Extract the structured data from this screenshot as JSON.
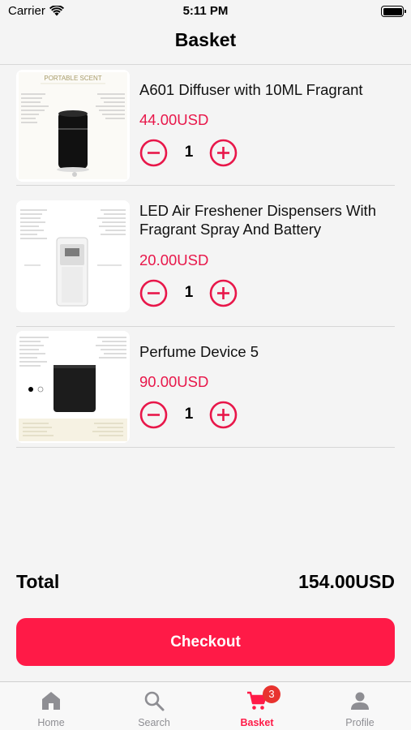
{
  "status_bar": {
    "carrier": "Carrier",
    "time": "5:11 PM"
  },
  "nav": {
    "title": "Basket"
  },
  "items": [
    {
      "name": "A601 Diffuser with 10ML Fragrant",
      "price": "44.00USD",
      "quantity": "1",
      "thumb_caption": "PORTABLE SCENT"
    },
    {
      "name": "LED Air Freshener Dispensers With Fragrant Spray And Battery",
      "price": "20.00USD",
      "quantity": "1",
      "thumb_caption": ""
    },
    {
      "name": "Perfume Device 5",
      "price": "90.00USD",
      "quantity": "1",
      "thumb_caption": ""
    }
  ],
  "summary": {
    "total_label": "Total",
    "total_value": "154.00USD"
  },
  "checkout_label": "Checkout",
  "tabs": [
    {
      "label": "Home",
      "icon": "home-icon",
      "active": false
    },
    {
      "label": "Search",
      "icon": "search-icon",
      "active": false
    },
    {
      "label": "Basket",
      "icon": "cart-icon",
      "active": true,
      "badge": "3"
    },
    {
      "label": "Profile",
      "icon": "profile-icon",
      "active": false
    }
  ],
  "colors": {
    "accent": "#ff1a47",
    "price": "#e8174a",
    "badge": "#e8332f",
    "inactive_tab": "#8e8e93"
  }
}
